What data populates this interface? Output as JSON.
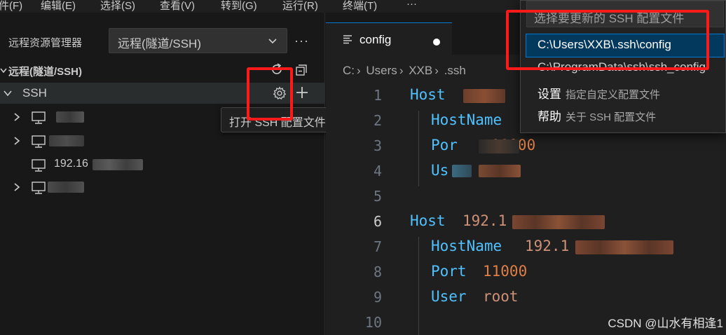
{
  "menubar": {
    "items": [
      "件(F)",
      "编辑(E)",
      "选择(S)",
      "查看(V)",
      "转到(G)",
      "运行(R)",
      "终端(T)",
      "···"
    ]
  },
  "sidebar": {
    "title": "远程资源管理器",
    "remote_select": "远程(隧道/SSH)",
    "more": "···",
    "section_title": "远程(隧道/SSH)",
    "ssh_group": "SSH",
    "hosts": [
      "",
      "",
      "192.16",
      ""
    ],
    "tooltip": "打开 SSH 配置文件"
  },
  "editor": {
    "tab_label": "config",
    "breadcrumb": [
      "C:",
      "Users",
      "XXB",
      ".ssh"
    ],
    "line_numbers": [
      "1",
      "2",
      "3",
      "4",
      "5",
      "6",
      "7",
      "8",
      "9",
      "10"
    ],
    "lines": {
      "l1_kw": "Host",
      "l2_kw": "HostName",
      "l3_kw": "Por",
      "l3_val": "11000",
      "l4_kw": "Us",
      "l6_kw": "Host",
      "l6_val": "192.1",
      "l7_kw": "HostName",
      "l7_val": "192.1",
      "l8_kw": "Port",
      "l8_val": "11000",
      "l9_kw": "User",
      "l9_val": "root"
    }
  },
  "quickpick": {
    "placeholder": "选择要更新的 SSH 配置文件",
    "items": [
      {
        "label": "C:\\Users\\XXB\\.ssh\\config",
        "desc": ""
      },
      {
        "label": "C:\\ProgramData\\ssh\\ssh_config",
        "desc": ""
      },
      {
        "label": "设置",
        "desc": "指定自定义配置文件"
      },
      {
        "label": "帮助",
        "desc": "关于 SSH 配置文件"
      }
    ]
  },
  "watermark": "CSDN @山水有相逢1",
  "colors": {
    "annotation": "#ff1a1a",
    "keyword": "#4fc1ff",
    "string": "#ce9178",
    "number": "#e07f45",
    "selection": "#04395e"
  }
}
